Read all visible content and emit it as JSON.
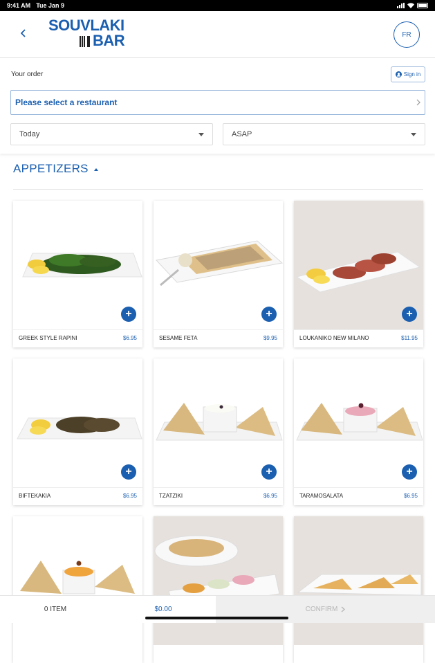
{
  "status_bar": {
    "time": "9:41 AM",
    "date": "Tue Jan 9"
  },
  "header": {
    "logo_line1": "SOUVLAKI",
    "logo_line2": "BAR",
    "language": "FR"
  },
  "order": {
    "label": "Your order",
    "sign_in": "Sign in",
    "restaurant_placeholder": "Please select a restaurant",
    "day_value": "Today",
    "time_value": "ASAP"
  },
  "section": {
    "title": "APPETIZERS"
  },
  "menu_items": [
    {
      "name": "GREEK STYLE RAPINI",
      "price": "$6.95"
    },
    {
      "name": "SESAME FETA",
      "price": "$9.95"
    },
    {
      "name": "LOUKANIKO NEW MILANO",
      "price": "$11.95"
    },
    {
      "name": "BIFTEKAKIA",
      "price": "$6.95"
    },
    {
      "name": "TZATZIKI",
      "price": "$6.95"
    },
    {
      "name": "TARAMOSALATA",
      "price": "$6.95"
    },
    {
      "name": "",
      "price": ""
    },
    {
      "name": "",
      "price": ""
    },
    {
      "name": "",
      "price": ""
    }
  ],
  "footer": {
    "items": "0 ITEM",
    "total": "$0.00",
    "confirm": "CONFIRM"
  },
  "colors": {
    "brand_blue": "#1b5fb0"
  }
}
